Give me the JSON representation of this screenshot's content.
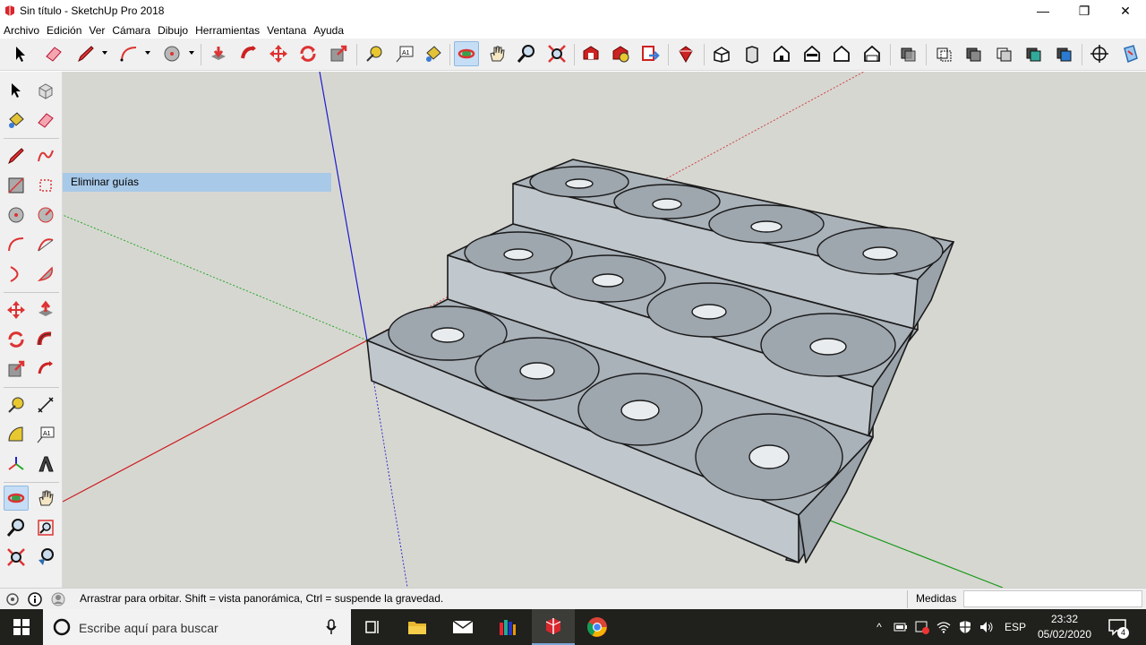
{
  "window": {
    "title": "Sin título - SketchUp Pro 2018",
    "minimize": "—",
    "maximize": "❐",
    "close": "✕"
  },
  "menu": [
    "Archivo",
    "Edición",
    "Ver",
    "Cámara",
    "Dibujo",
    "Herramientas",
    "Ventana",
    "Ayuda"
  ],
  "toolbar": {
    "icons": [
      "select-icon",
      "eraser-icon",
      "pencil-icon",
      "arc-icon",
      "circle-icon",
      "push-pull-icon",
      "follow-me-icon",
      "move-icon",
      "rotate-icon",
      "scale-icon",
      "tape-measure-icon",
      "text-icon",
      "paint-bucket-icon",
      "orbit-icon",
      "pan-icon",
      "zoom-icon",
      "zoom-extents-icon",
      "warehouse-icon",
      "extension-warehouse-icon",
      "send-to-layout-icon",
      "extension-manager-icon",
      "iso-view-icon",
      "top-view-icon",
      "front-view-icon",
      "right-view-icon",
      "back-view-icon",
      "left-view-icon",
      "xray-icon",
      "back-edges-icon",
      "wireframe-icon",
      "hidden-line-icon",
      "shaded-icon",
      "shaded-textures-icon",
      "monochrome-icon",
      "section-plane-icon",
      "section-display-icon"
    ],
    "active": "orbit-icon"
  },
  "tooltip": {
    "text": "Eliminar guías"
  },
  "status": {
    "hint": "Arrastrar para orbitar. Shift = vista panorámica, Ctrl = suspende la gravedad.",
    "measures_label": "Medidas",
    "measures_value": ""
  },
  "taskbar": {
    "search_placeholder": "Escribe aquí para buscar",
    "language": "ESP",
    "time": "23:32",
    "date": "05/02/2020",
    "notifications": "4"
  }
}
